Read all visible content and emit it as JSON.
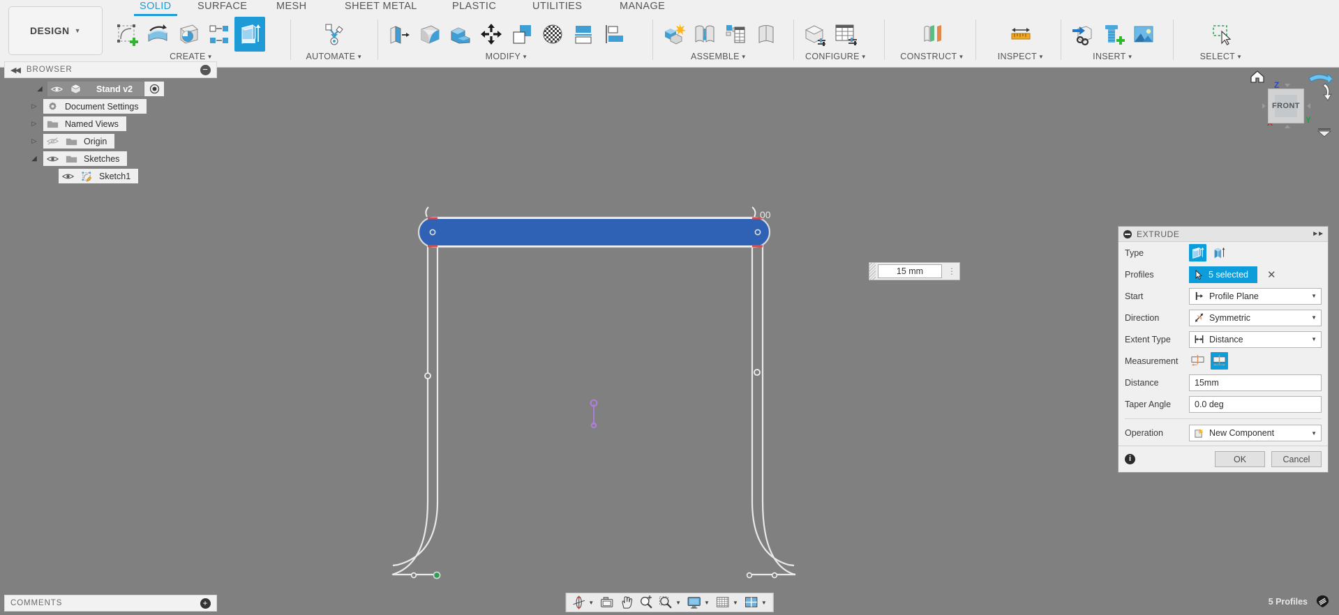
{
  "app": {
    "workspace_label": "DESIGN",
    "tabs": [
      {
        "label": "SOLID",
        "active": true
      },
      {
        "label": "SURFACE",
        "active": false
      },
      {
        "label": "MESH",
        "active": false
      },
      {
        "label": "SHEET METAL",
        "active": false
      },
      {
        "label": "PLASTIC",
        "active": false
      },
      {
        "label": "UTILITIES",
        "active": false
      },
      {
        "label": "MANAGE",
        "active": false
      }
    ],
    "groups": [
      {
        "label": "CREATE",
        "icons": [
          "create-sketch-icon",
          "revolve-icon",
          "sphere-icon",
          "pattern-icon",
          "extrude-icon"
        ]
      },
      {
        "label": "AUTOMATE",
        "icons": [
          "automate-icon"
        ]
      },
      {
        "label": "MODIFY",
        "icons": [
          "press-pull-icon",
          "fillet-icon",
          "shell-icon",
          "move-copy-icon",
          "combine-icon",
          "material-icon",
          "split-face-icon",
          "align-icon"
        ]
      },
      {
        "label": "ASSEMBLE",
        "icons": [
          "new-component-icon",
          "joint-icon",
          "joint-origin-icon",
          "rigid-group-icon"
        ]
      },
      {
        "label": "CONFIGURE",
        "icons": [
          "configuration-icon",
          "configuration-table-icon"
        ]
      },
      {
        "label": "CONSTRUCT",
        "icons": [
          "offset-plane-icon"
        ]
      },
      {
        "label": "INSPECT",
        "icons": [
          "measure-icon"
        ]
      },
      {
        "label": "INSERT",
        "icons": [
          "insert-derive-icon",
          "insert-mcmaster-icon",
          "insert-canvas-icon"
        ]
      },
      {
        "label": "SELECT",
        "icons": [
          "select-window-icon"
        ]
      }
    ]
  },
  "browser": {
    "title": "BROWSER",
    "collapse_icon": "collapse-left-icon",
    "minimize_icon": "minus-icon",
    "items": [
      {
        "label": "Stand v2",
        "indent": 0,
        "expander": "open",
        "eye": "eye-visible-icon",
        "icon": "component-icon",
        "root": true,
        "trailing": "radio-icon"
      },
      {
        "label": "Document Settings",
        "indent": 1,
        "expander": "closed",
        "eye": null,
        "icon": "gear-icon",
        "root": false
      },
      {
        "label": "Named Views",
        "indent": 1,
        "expander": "closed",
        "eye": null,
        "icon": "folder-icon",
        "root": false
      },
      {
        "label": "Origin",
        "indent": 1,
        "expander": "closed",
        "eye": "eye-hidden-icon",
        "icon": "folder-icon",
        "root": false
      },
      {
        "label": "Sketches",
        "indent": 1,
        "expander": "open",
        "eye": "eye-visible-icon",
        "icon": "folder-icon",
        "root": false
      },
      {
        "label": "Sketch1",
        "indent": 2,
        "expander": null,
        "eye": "eye-visible-icon",
        "icon": "sketch-icon",
        "root": false
      }
    ]
  },
  "canvas": {
    "value_box": {
      "value": "15 mm",
      "overflow_icon": "more-vertical-icon",
      "grip_icon": "drag-grip-icon"
    },
    "dimension_label": "00",
    "viewcube": {
      "face_label": "FRONT",
      "home_icon": "home-icon",
      "orbit_ccw_icon": "orbit-arrow-left-icon",
      "orbit_cw_icon": "orbit-arrow-right-icon",
      "more_icon": "viewcube-menu-icon",
      "axis_x": "X",
      "axis_y": "Y",
      "axis_z": "Z"
    }
  },
  "extrude": {
    "title": "EXTRUDE",
    "collapse_icon": "minus-circle-icon",
    "pin_icon": "expand-right-icon",
    "rows": {
      "type": {
        "label": "Type",
        "options": [
          "type-solid-icon",
          "type-thin-icon"
        ],
        "selected_index": 0
      },
      "profiles": {
        "label": "Profiles",
        "value": "5 selected",
        "cursor_icon": "pick-cursor-icon",
        "clear_icon": "close-x-icon"
      },
      "start": {
        "label": "Start",
        "value": "Profile Plane",
        "icon": "profile-plane-icon"
      },
      "direction": {
        "label": "Direction",
        "value": "Symmetric",
        "icon": "symmetric-icon"
      },
      "extent_type": {
        "label": "Extent Type",
        "value": "Distance",
        "icon": "distance-icon"
      },
      "measurement": {
        "label": "Measurement",
        "options": [
          "half-length-icon",
          "whole-length-icon"
        ],
        "selected_index": 1
      },
      "distance": {
        "label": "Distance",
        "value": "15mm"
      },
      "taper_angle": {
        "label": "Taper Angle",
        "value": "0.0 deg"
      },
      "operation": {
        "label": "Operation",
        "value": "New Component",
        "icon": "new-component-op-icon"
      }
    },
    "footer": {
      "info_icon": "info-icon",
      "ok_label": "OK",
      "cancel_label": "Cancel"
    }
  },
  "comments": {
    "title": "COMMENTS",
    "add_icon": "plus-icon"
  },
  "navbar": {
    "buttons": [
      {
        "name": "orbit-icon",
        "caret": true
      },
      {
        "name": "look-at-icon",
        "caret": false
      },
      {
        "name": "pan-icon",
        "caret": false
      },
      {
        "name": "zoom-icon",
        "caret": false
      },
      {
        "name": "zoom-window-icon",
        "caret": true
      },
      {
        "name": "display-settings-icon",
        "caret": true
      },
      {
        "name": "grid-snap-icon",
        "caret": true
      },
      {
        "name": "viewports-icon",
        "caret": true
      }
    ]
  },
  "status": {
    "text": "5 Profiles",
    "icon": "select-filter-icon"
  }
}
